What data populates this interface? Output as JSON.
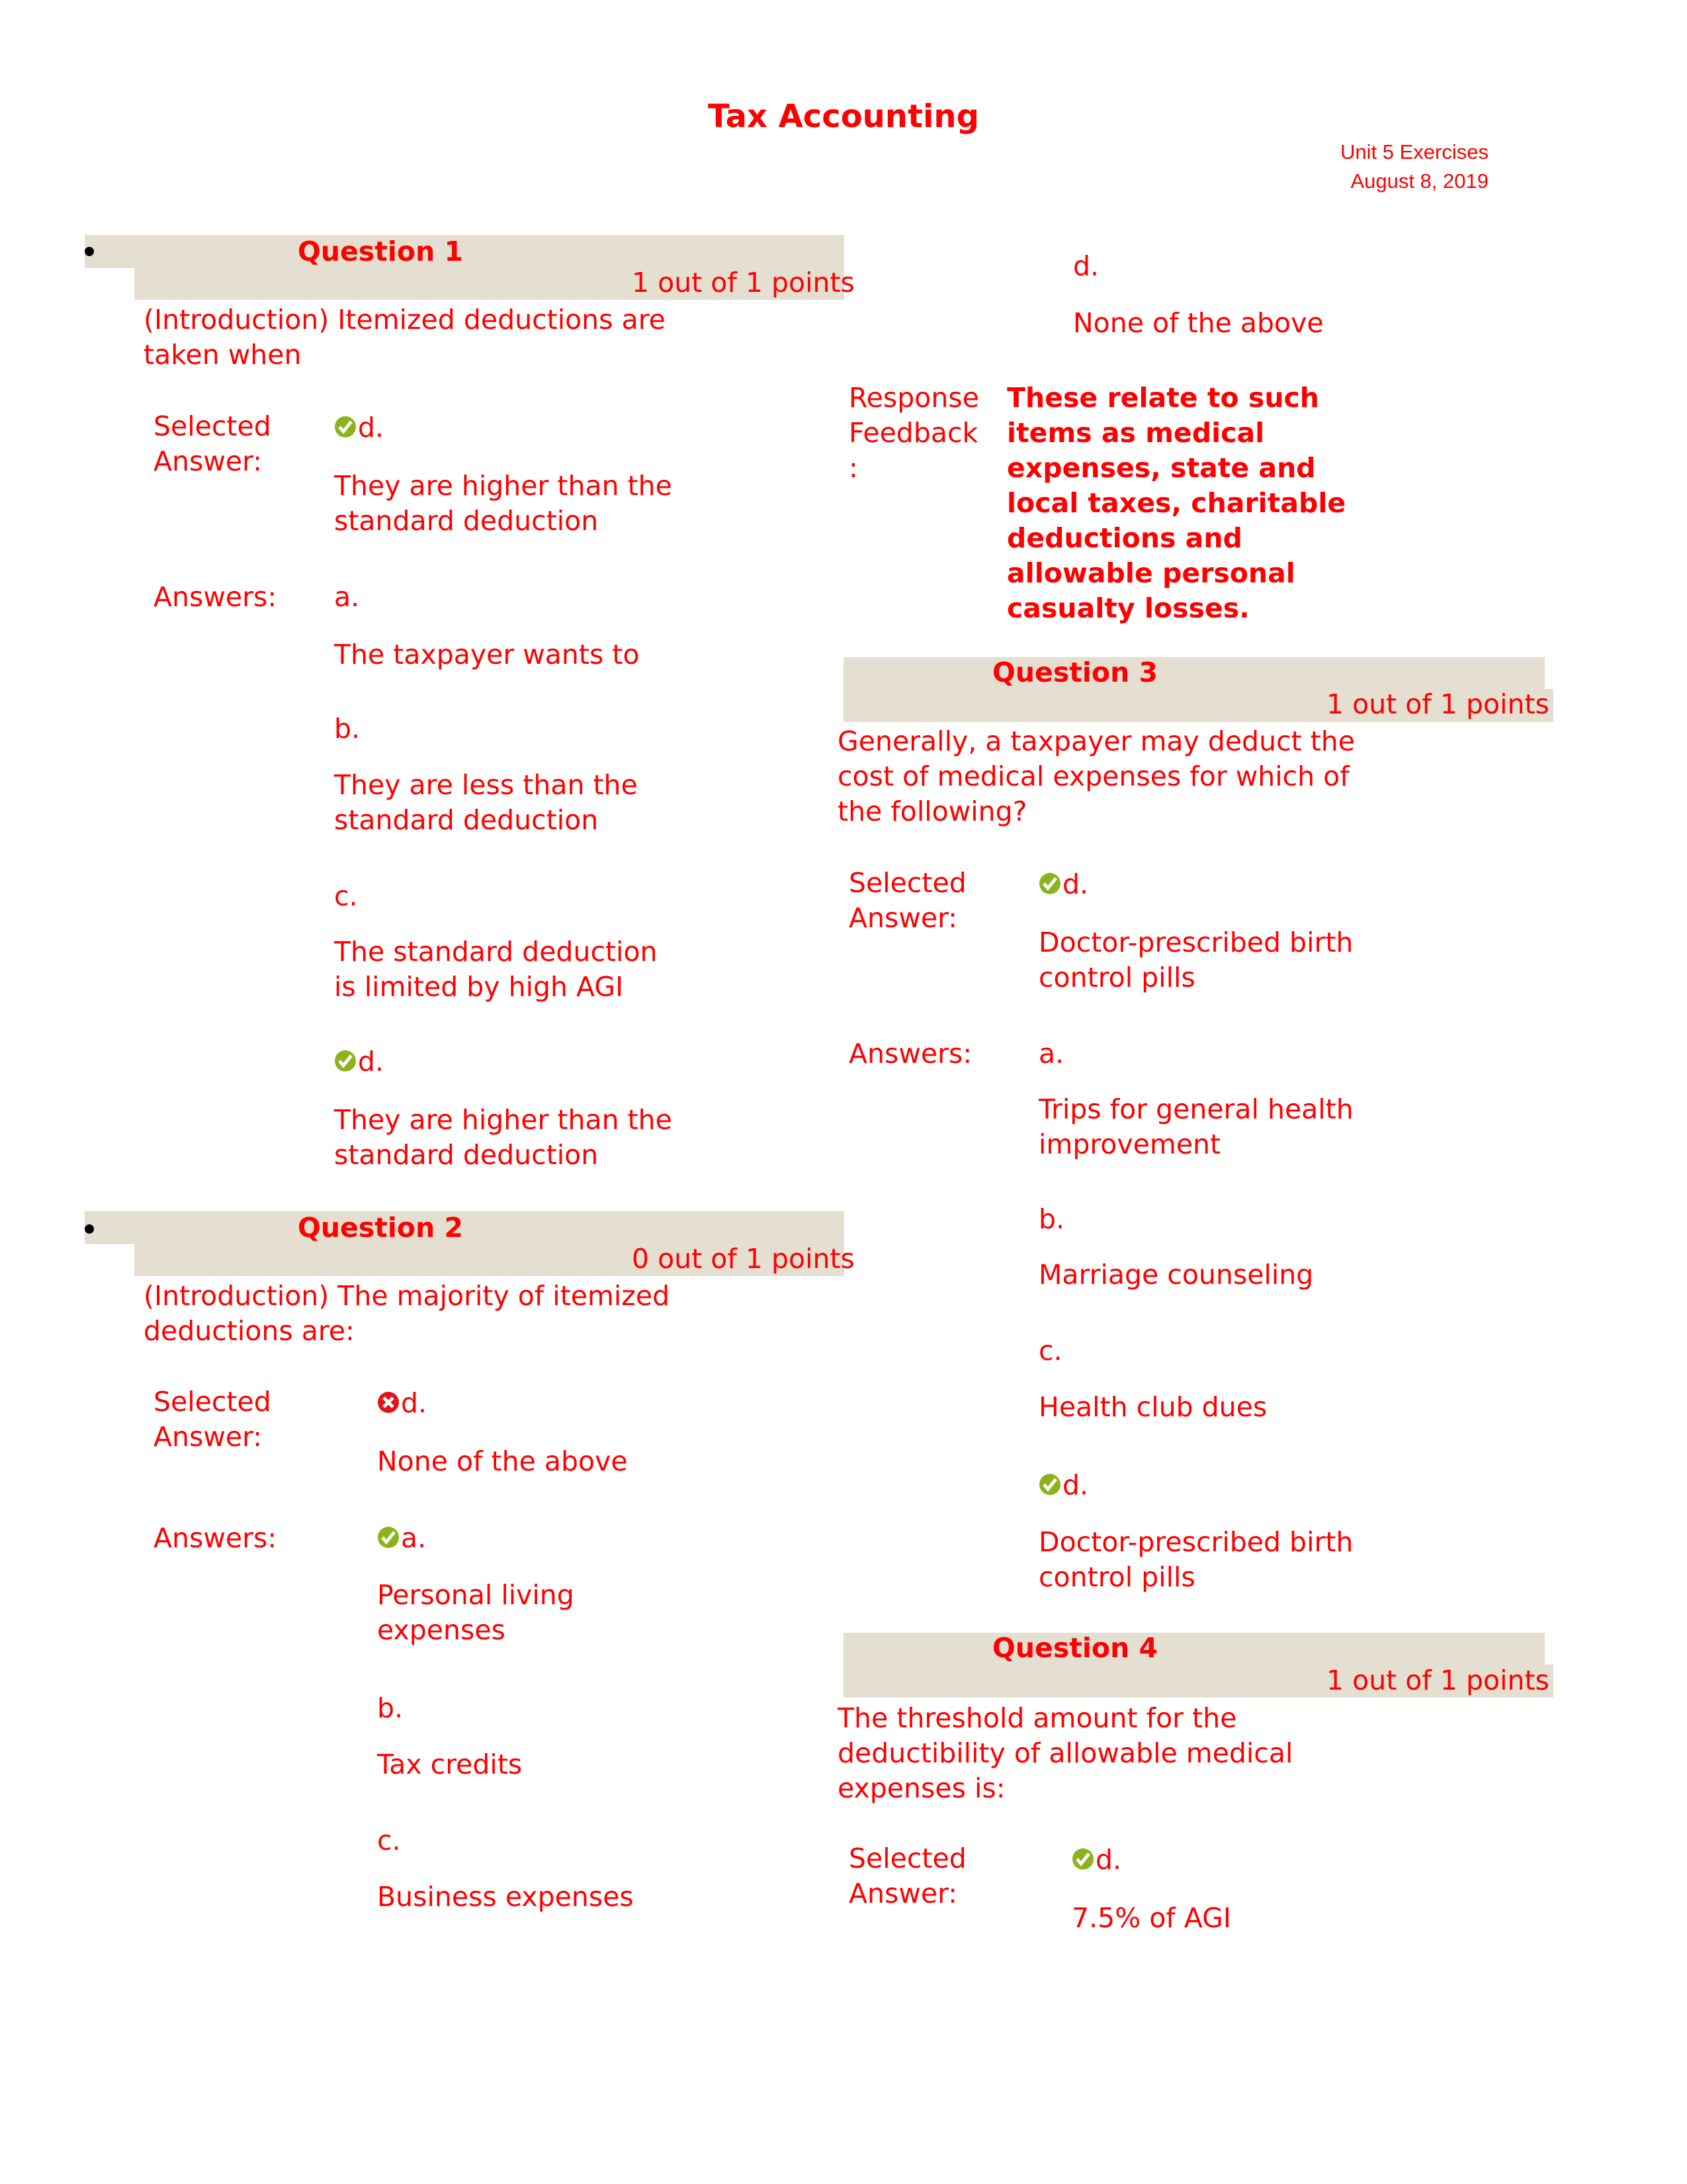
{
  "document": {
    "title": "Tax Accounting",
    "subtitle": "Unit 5 Exercises",
    "date": "August 8, 2019"
  },
  "colors": {
    "text": "#ff0000",
    "header_band": "#e4dfd0",
    "correct_icon": "#8cb31c",
    "incorrect_icon": "#e0151b"
  },
  "labels": {
    "selected_answer_line1": "Selected",
    "selected_answer_line2": "Answer:",
    "answers": "Answers:",
    "response_feedback_line1": "Response",
    "response_feedback_line2": "Feedback",
    "response_feedback_line3": ":"
  },
  "questions": [
    {
      "title": "Question 1",
      "points": "1 out of 1 points",
      "prompt_line1": "(Introduction) Itemized deductions are",
      "prompt_line2": "taken when",
      "selected": {
        "letter": "d.",
        "icon": "check-icon",
        "text_line1": "They are higher than the",
        "text_line2": "standard deduction"
      },
      "answers": [
        {
          "letter": "a.",
          "icon": null,
          "text_line1": "The taxpayer wants to",
          "text_line2": ""
        },
        {
          "letter": "b.",
          "icon": null,
          "text_line1": "They are less than the",
          "text_line2": "standard deduction"
        },
        {
          "letter": "c.",
          "icon": null,
          "text_line1": "The standard deduction",
          "text_line2": "is limited by high AGI"
        },
        {
          "letter": "d.",
          "icon": "check-icon",
          "text_line1": "They are higher than the",
          "text_line2": "standard deduction"
        }
      ]
    },
    {
      "title": "Question 2",
      "points": "0 out of 1 points",
      "prompt_line1": "(Introduction) The majority of itemized",
      "prompt_line2": "deductions are:",
      "selected": {
        "letter": "d.",
        "icon": "x-icon",
        "text_line1": "None of the above",
        "text_line2": ""
      },
      "answers": [
        {
          "letter": "a.",
          "icon": "check-icon",
          "text_line1": "Personal living",
          "text_line2": "expenses"
        },
        {
          "letter": "b.",
          "icon": null,
          "text_line1": "Tax credits",
          "text_line2": ""
        },
        {
          "letter": "c.",
          "icon": null,
          "text_line1": "Business expenses",
          "text_line2": ""
        },
        {
          "letter": "d.",
          "icon": null,
          "text_line1": "None of the above",
          "text_line2": ""
        }
      ],
      "feedback_lines": [
        "These relate to such",
        "items as medical",
        "expenses, state and",
        "local taxes, charitable",
        "deductions and",
        "allowable personal",
        "casualty losses."
      ]
    },
    {
      "title": "Question 3",
      "points": "1 out of 1 points",
      "prompt_line1": "Generally, a taxpayer may deduct the",
      "prompt_line2": "cost of medical expenses for which of",
      "prompt_line3": "the following?",
      "selected": {
        "letter": "d.",
        "icon": "check-icon",
        "text_line1": "Doctor-prescribed birth",
        "text_line2": "control pills"
      },
      "answers": [
        {
          "letter": "a.",
          "icon": null,
          "text_line1": "Trips for general health",
          "text_line2": "improvement"
        },
        {
          "letter": "b.",
          "icon": null,
          "text_line1": "Marriage counseling",
          "text_line2": ""
        },
        {
          "letter": "c.",
          "icon": null,
          "text_line1": "Health club dues",
          "text_line2": ""
        },
        {
          "letter": "d.",
          "icon": "check-icon",
          "text_line1": "Doctor-prescribed birth",
          "text_line2": "control pills"
        }
      ]
    },
    {
      "title": "Question 4",
      "points": "1 out of 1 points",
      "prompt_line1": "The threshold amount for the",
      "prompt_line2": "deductibility of allowable medical",
      "prompt_line3": "expenses is:",
      "selected": {
        "letter": "d.",
        "icon": "check-icon",
        "text_line1": "7.5% of AGI",
        "text_line2": ""
      }
    }
  ]
}
